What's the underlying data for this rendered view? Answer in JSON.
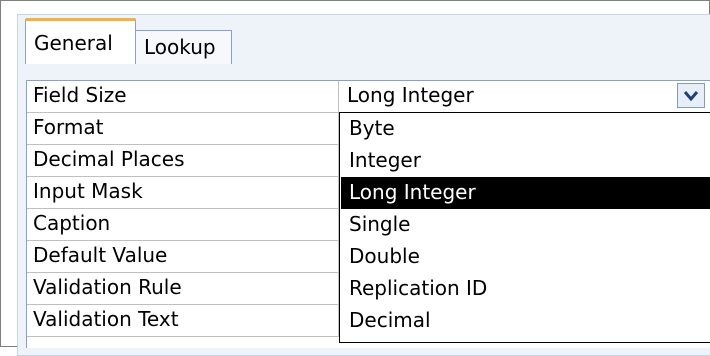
{
  "tabs": [
    {
      "label": "General",
      "active": true
    },
    {
      "label": "Lookup",
      "active": false
    }
  ],
  "properties": [
    {
      "label": "Field Size",
      "value": "Long Integer"
    },
    {
      "label": "Format",
      "value": ""
    },
    {
      "label": "Decimal Places",
      "value": ""
    },
    {
      "label": "Input Mask",
      "value": ""
    },
    {
      "label": "Caption",
      "value": ""
    },
    {
      "label": "Default Value",
      "value": ""
    },
    {
      "label": "Validation Rule",
      "value": ""
    },
    {
      "label": "Validation Text",
      "value": ""
    }
  ],
  "dropdown": {
    "button_icon": "chevron-down-icon",
    "options": [
      "Byte",
      "Integer",
      "Long Integer",
      "Single",
      "Double",
      "Replication ID",
      "Decimal"
    ],
    "selected": "Long Integer"
  },
  "colors": {
    "panel_bg": "#eef3fa",
    "active_tab_accent": "#f2b23e",
    "selected_bg": "#000000",
    "selected_text": "#ffffff"
  }
}
